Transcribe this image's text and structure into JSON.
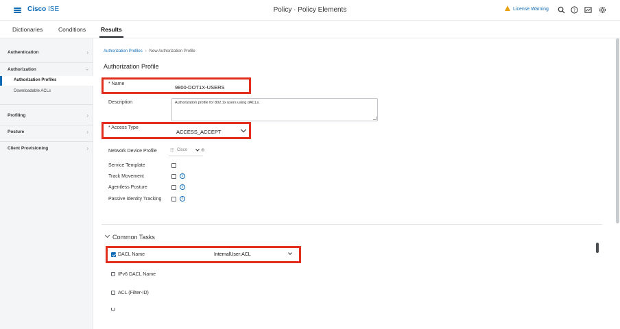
{
  "header": {
    "brand": "Cisco",
    "brand_sub": "ISE",
    "title": "Policy · Policy Elements",
    "license_warning": "License Warning",
    "icons": [
      "search-icon",
      "help-icon",
      "dashboard-icon",
      "gear-icon"
    ]
  },
  "tabs": [
    {
      "label": "Dictionaries"
    },
    {
      "label": "Conditions"
    },
    {
      "label": "Results",
      "active": true
    }
  ],
  "sidebar": {
    "sections": [
      {
        "label": "Authentication",
        "expanded": false
      },
      {
        "label": "Authorization",
        "expanded": true
      },
      {
        "label": "Profiling",
        "expanded": false
      },
      {
        "label": "Posture",
        "expanded": false
      },
      {
        "label": "Client Provisioning",
        "expanded": false
      }
    ],
    "authorization_items": [
      {
        "label": "Authorization Profiles",
        "active": true
      },
      {
        "label": "Downloadable ACLs",
        "active": false
      }
    ]
  },
  "breadcrumb": {
    "parent": "Authorization Profiles",
    "current": "New Authorization Profile"
  },
  "form": {
    "title": "Authorization Profile",
    "name_label": "* Name",
    "name_value": "9800-DOT1X-USERS",
    "description_label": "Description",
    "description_value": "Authorization profile for 802.1x users using dACLs.",
    "access_type_label": "* Access Type",
    "access_type_value": "ACCESS_ACCEPT",
    "ndp_label": "Network Device Profile",
    "ndp_value": "Cisco",
    "service_template_label": "Service Template",
    "track_movement_label": "Track Movement",
    "agentless_posture_label": "Agentless Posture",
    "passive_identity_label": "Passive Identity Tracking"
  },
  "common_tasks": {
    "title": "Common Tasks",
    "dacl_label": "DACL Name",
    "dacl_value": "InternalUser:ACL",
    "ipv6_dacl_label": "IPv6 DACL Name",
    "acl_filter_label": "ACL  (Filter-ID)"
  },
  "colors": {
    "accent": "#0d6bb6",
    "highlight": "#e22f1d",
    "warning": "#e8a317"
  }
}
